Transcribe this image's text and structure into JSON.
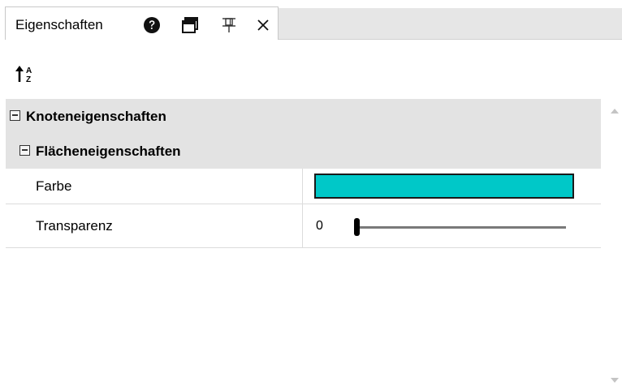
{
  "tab": {
    "title": "Eigenschaften",
    "icons": [
      "help-icon",
      "window-icon",
      "pin-icon",
      "close-icon"
    ]
  },
  "toolbar": {
    "sort_icon": "sort-alphabetical-icon"
  },
  "grid": {
    "categories": [
      {
        "label": "Knoteneigenschaften",
        "expanded": true
      },
      {
        "label": "Flächeneigenschaften",
        "expanded": true
      }
    ],
    "properties": [
      {
        "name": "Farbe",
        "value_color": "#00c8c8"
      },
      {
        "name": "Transparenz",
        "value": "0",
        "slider_fraction": 0.0
      }
    ]
  },
  "colors": {
    "tab_bg": "#ffffff",
    "strip_bg": "#e6e6e6",
    "category_bg": "#e3e3e3",
    "swatch": "#00c8c8",
    "slider_track": "#7a7a7a"
  }
}
